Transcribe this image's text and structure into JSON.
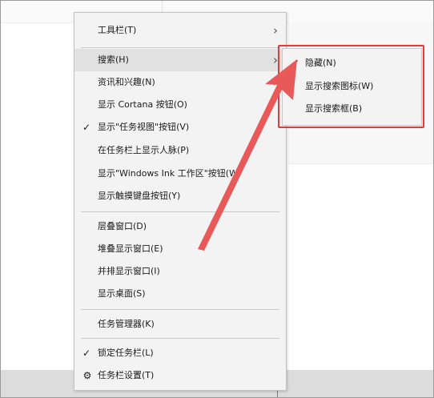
{
  "context_menu": {
    "items": [
      {
        "label": "工具栏(T)",
        "submenu": true
      },
      {
        "label": "搜索(H)",
        "submenu": true,
        "highlighted": true
      },
      {
        "label": "资讯和兴趣(N)",
        "submenu": true
      },
      {
        "label": "显示 Cortana 按钮(O)"
      },
      {
        "label": "显示\"任务视图\"按钮(V)",
        "checked": true
      },
      {
        "label": "在任务栏上显示人脉(P)"
      },
      {
        "label": "显示\"Windows Ink 工作区\"按钮(W)"
      },
      {
        "label": "显示触摸键盘按钮(Y)"
      },
      {
        "label": "层叠窗口(D)"
      },
      {
        "label": "堆叠显示窗口(E)"
      },
      {
        "label": "并排显示窗口(I)"
      },
      {
        "label": "显示桌面(S)"
      },
      {
        "label": "任务管理器(K)"
      },
      {
        "label": "锁定任务栏(L)",
        "checked": true
      },
      {
        "label": "任务栏设置(T)",
        "icon": "gear-icon"
      }
    ]
  },
  "search_submenu": {
    "items": [
      {
        "label": "隐藏(N)",
        "checked": true
      },
      {
        "label": "显示搜索图标(W)"
      },
      {
        "label": "显示搜索框(B)"
      }
    ]
  },
  "icons": {
    "check": "checkmark-icon",
    "arrow": "chevron-right-icon",
    "gear": "gear-icon"
  },
  "colors": {
    "menu_bg": "#f3f3f3",
    "highlight": "#e1e1e1",
    "annotation_red": "#e03c3c",
    "taskbar": "#dcdcdc"
  }
}
